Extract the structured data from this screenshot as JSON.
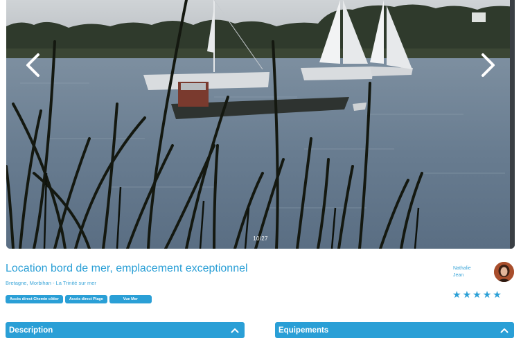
{
  "gallery": {
    "counter": "10/27",
    "prev_icon": "chevron-left-icon",
    "next_icon": "chevron-right-icon"
  },
  "listing": {
    "title": "Location bord de mer, emplacement exceptionnel",
    "location": "Bretagne, Morbihan - La Trinité sur mer",
    "tags": [
      "Accès direct Chemin côtier",
      "Accès direct Plage",
      "Vue Mer"
    ]
  },
  "host": {
    "first_name": "Nathalie",
    "last_name": "Jean",
    "rating": 5,
    "stars": [
      "★",
      "★",
      "★",
      "★",
      "★"
    ]
  },
  "sections": {
    "description_label": "Description",
    "equipment_label": "Equipements"
  },
  "colors": {
    "accent": "#2a9fd6",
    "white": "#ffffff"
  }
}
